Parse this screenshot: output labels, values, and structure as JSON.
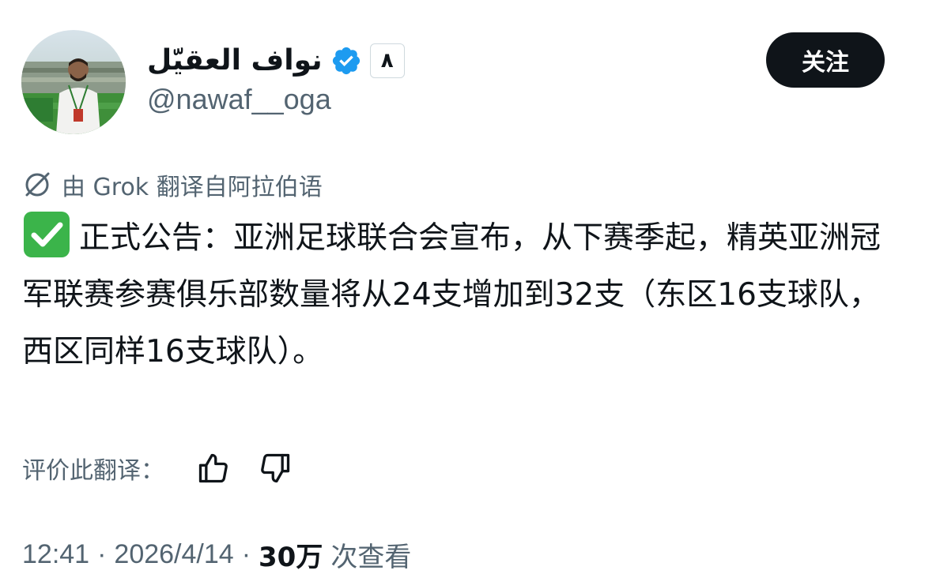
{
  "author": {
    "display_name": "نواف العقيّل",
    "handle": "@nawaf__oga",
    "badge_emoji": "٨",
    "verified_color": "#1d9bf0"
  },
  "follow_button": {
    "label": "关注"
  },
  "translation": {
    "notice": "由 Grok 翻译自阿拉伯语",
    "icon": "translate-slash-icon"
  },
  "tweet": {
    "emoji": "white-check-mark",
    "text": "正式公告：亚洲足球联合会宣布，从下赛季起，精英亚洲冠军联赛参赛俱乐部数量将从24支增加到32支（东区16支球队，西区同样16支球队）。"
  },
  "rating": {
    "label": "评价此翻译：",
    "thumbs_up_icon": "thumbs-up-icon",
    "thumbs_down_icon": "thumbs-down-icon"
  },
  "meta": {
    "time": "12:41",
    "separator": "·",
    "date": "2026/4/14",
    "views_count": "30万",
    "views_label": "次查看"
  },
  "colors": {
    "text_primary": "#0f1419",
    "text_secondary": "#536471",
    "verified": "#1d9bf0",
    "check_green": "#3bb44a"
  }
}
